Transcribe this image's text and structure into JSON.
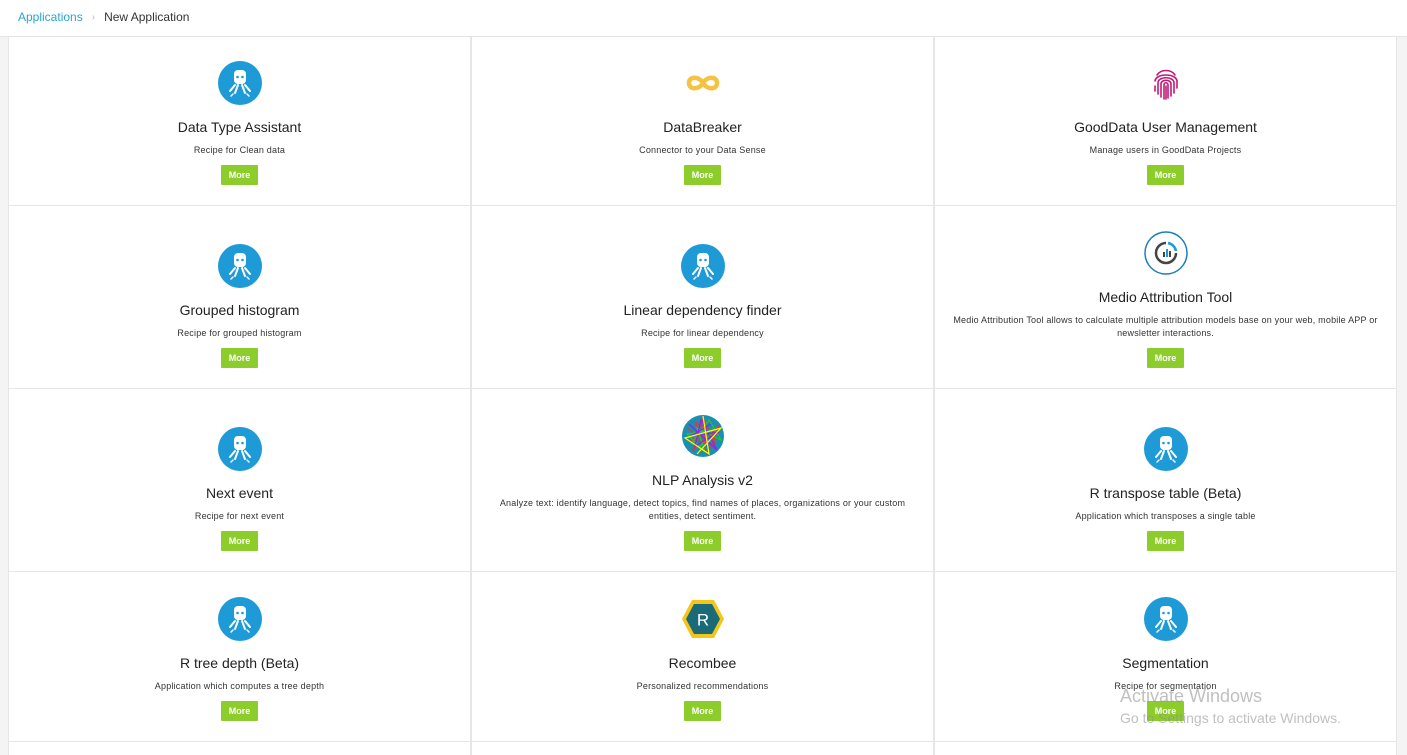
{
  "breadcrumb": {
    "root": "Applications",
    "separator": "›",
    "current": "New Application"
  },
  "colors": {
    "accent": "#2ba6cb",
    "button": "#8ccd2c",
    "keboola_icon": "#1e9bd7"
  },
  "cards": [
    {
      "icon": "keboola-robot-icon",
      "title": "Data Type Assistant",
      "desc": "Recipe for Clean data",
      "button": "More"
    },
    {
      "icon": "infinity-icon",
      "title": "DataBreaker",
      "desc": "Connector to your Data Sense",
      "button": "More"
    },
    {
      "icon": "fingerprint-icon",
      "title": "GoodData User Management",
      "desc": "Manage users in GoodData Projects",
      "button": "More"
    },
    {
      "icon": "keboola-robot-icon",
      "title": "Grouped histogram",
      "desc": "Recipe for grouped histogram",
      "button": "More"
    },
    {
      "icon": "keboola-robot-icon",
      "title": "Linear dependency finder",
      "desc": "Recipe for linear dependency",
      "button": "More"
    },
    {
      "icon": "medio-chart-icon",
      "title": "Medio Attribution Tool",
      "desc": "Medio Attribution Tool allows to calculate multiple attribution models base on your web, mobile APP or newsletter interactions.",
      "button": "More"
    },
    {
      "icon": "keboola-robot-icon",
      "title": "Next event",
      "desc": "Recipe for next event",
      "button": "More"
    },
    {
      "icon": "nlp-network-icon",
      "title": "NLP Analysis v2",
      "desc": "Analyze text: identify language, detect topics, find names of places, organizations or your custom entities, detect sentiment.",
      "button": "More"
    },
    {
      "icon": "keboola-robot-icon",
      "title": "R transpose table (Beta)",
      "desc": "Application which transposes a single table",
      "button": "More"
    },
    {
      "icon": "keboola-robot-icon",
      "title": "R tree depth (Beta)",
      "desc": "Application which computes a tree depth",
      "button": "More"
    },
    {
      "icon": "recombee-hexagon-icon",
      "title": "Recombee",
      "desc": "Personalized recommendations",
      "button": "More"
    },
    {
      "icon": "keboola-robot-icon",
      "title": "Segmentation",
      "desc": "Recipe for segmentation",
      "button": "More"
    }
  ],
  "watermark": {
    "title": "Activate Windows",
    "subtitle": "Go to Settings to activate Windows."
  }
}
